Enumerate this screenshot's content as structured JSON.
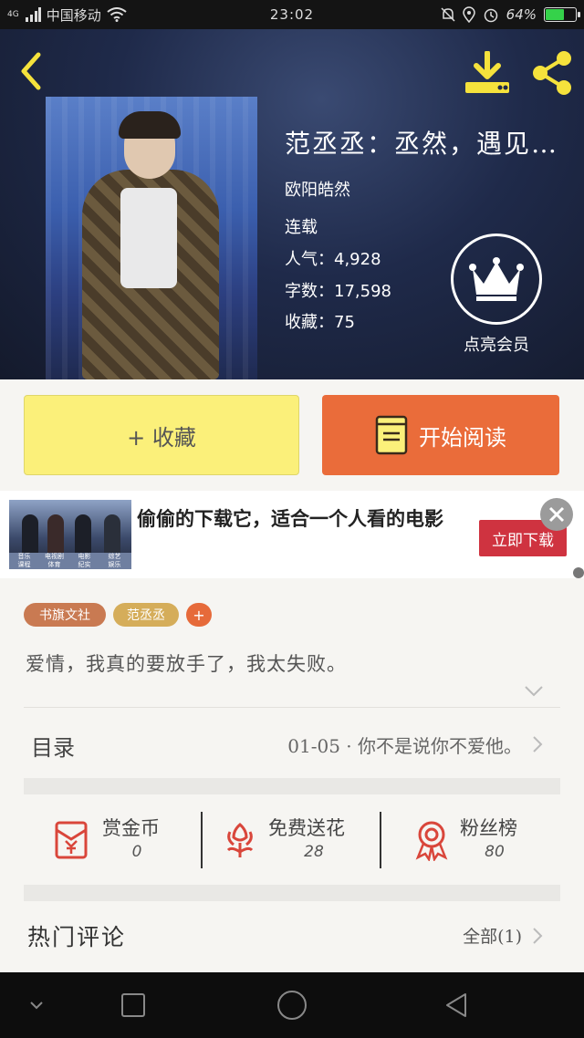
{
  "status_bar": {
    "network": "4G",
    "carrier": "中国移动",
    "time": "23:02",
    "battery": "64%",
    "icons": [
      "signal-icon",
      "wifi-icon",
      "dnd-icon",
      "location-icon",
      "alarm-icon",
      "battery-icon"
    ],
    "battery_level": 0.64
  },
  "book": {
    "title": "范丞丞：丞然，遇见…",
    "author": "欧阳皓然",
    "status": "连载",
    "popularity": "人气：4,928",
    "word_count": "字数：17,598",
    "favorites": "收藏：75",
    "vip_label": "点亮会员"
  },
  "actions": {
    "favorite": "+ 收藏",
    "read": "开始阅读"
  },
  "ad": {
    "text": "偷偷的下载它，适合一个人看的电影",
    "cta": "立即下载",
    "thumb_labels": [
      "音乐",
      "电视剧",
      "电影",
      "综艺",
      "课程",
      "体育",
      "纪实",
      "娱乐"
    ]
  },
  "tags": {
    "publisher": "书旗文社",
    "subject": "范丞丞",
    "add": "+"
  },
  "synopsis": "爱情，我真的要放手了，我太失败。",
  "toc": {
    "label": "目录",
    "latest": "01-05 · 你不是说你不爱他。"
  },
  "stats": {
    "reward": {
      "label": "赏金币",
      "value": "0"
    },
    "flower": {
      "label": "免费送花",
      "value": "28"
    },
    "fans": {
      "label": "粉丝榜",
      "value": "80"
    }
  },
  "comments": {
    "title": "热门评论",
    "all": "全部(1)"
  },
  "colors": {
    "accent_yellow": "#fbf07a",
    "accent_orange": "#ea6c3a",
    "icon_yellow": "#f5e23c",
    "icon_red": "#d9463b",
    "ad_cta": "#cf3340"
  }
}
